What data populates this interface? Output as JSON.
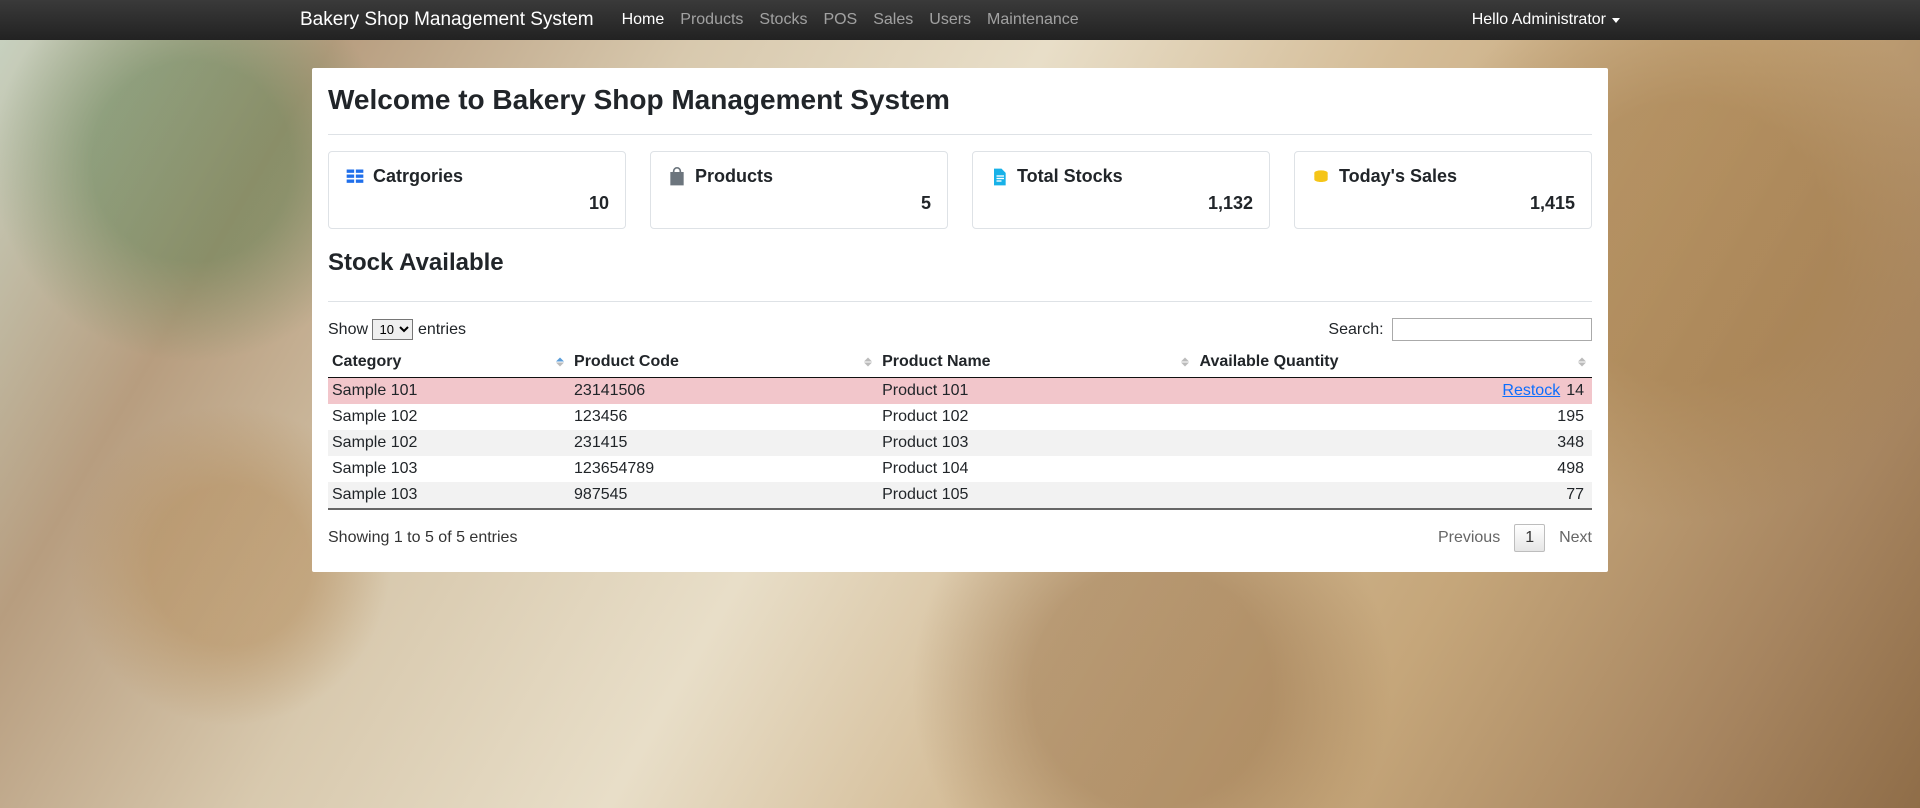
{
  "navbar": {
    "brand": "Bakery Shop Management System",
    "links": [
      "Home",
      "Products",
      "Stocks",
      "POS",
      "Sales",
      "Users",
      "Maintenance"
    ],
    "active_index": 0,
    "user_label": "Hello Administrator"
  },
  "page": {
    "title": "Welcome to Bakery Shop Management System",
    "section_title": "Stock Available"
  },
  "stats": [
    {
      "icon": "grid",
      "label": "Catrgories",
      "value": "10"
    },
    {
      "icon": "bag",
      "label": "Products",
      "value": "5"
    },
    {
      "icon": "file",
      "label": "Total Stocks",
      "value": "1,132"
    },
    {
      "icon": "coins",
      "label": "Today's Sales",
      "value": "1,415"
    }
  ],
  "datatable": {
    "length": {
      "prefix": "Show",
      "suffix": "entries",
      "value": "10"
    },
    "search_label": "Search:",
    "columns": [
      "Category",
      "Product Code",
      "Product Name",
      "Available Quantity"
    ],
    "sorted_col": 0,
    "rows": [
      {
        "category": "Sample 101",
        "code": "23141506",
        "name": "Product 101",
        "qty": "14",
        "low": true
      },
      {
        "category": "Sample 102",
        "code": "123456",
        "name": "Product 102",
        "qty": "195",
        "low": false
      },
      {
        "category": "Sample 102",
        "code": "231415",
        "name": "Product 103",
        "qty": "348",
        "low": false
      },
      {
        "category": "Sample 103",
        "code": "123654789",
        "name": "Product 104",
        "qty": "498",
        "low": false
      },
      {
        "category": "Sample 103",
        "code": "987545",
        "name": "Product 105",
        "qty": "77",
        "low": false
      }
    ],
    "restock_label": "Restock",
    "info": "Showing 1 to 5 of 5 entries",
    "paginate": {
      "prev": "Previous",
      "next": "Next",
      "current": "1"
    }
  }
}
